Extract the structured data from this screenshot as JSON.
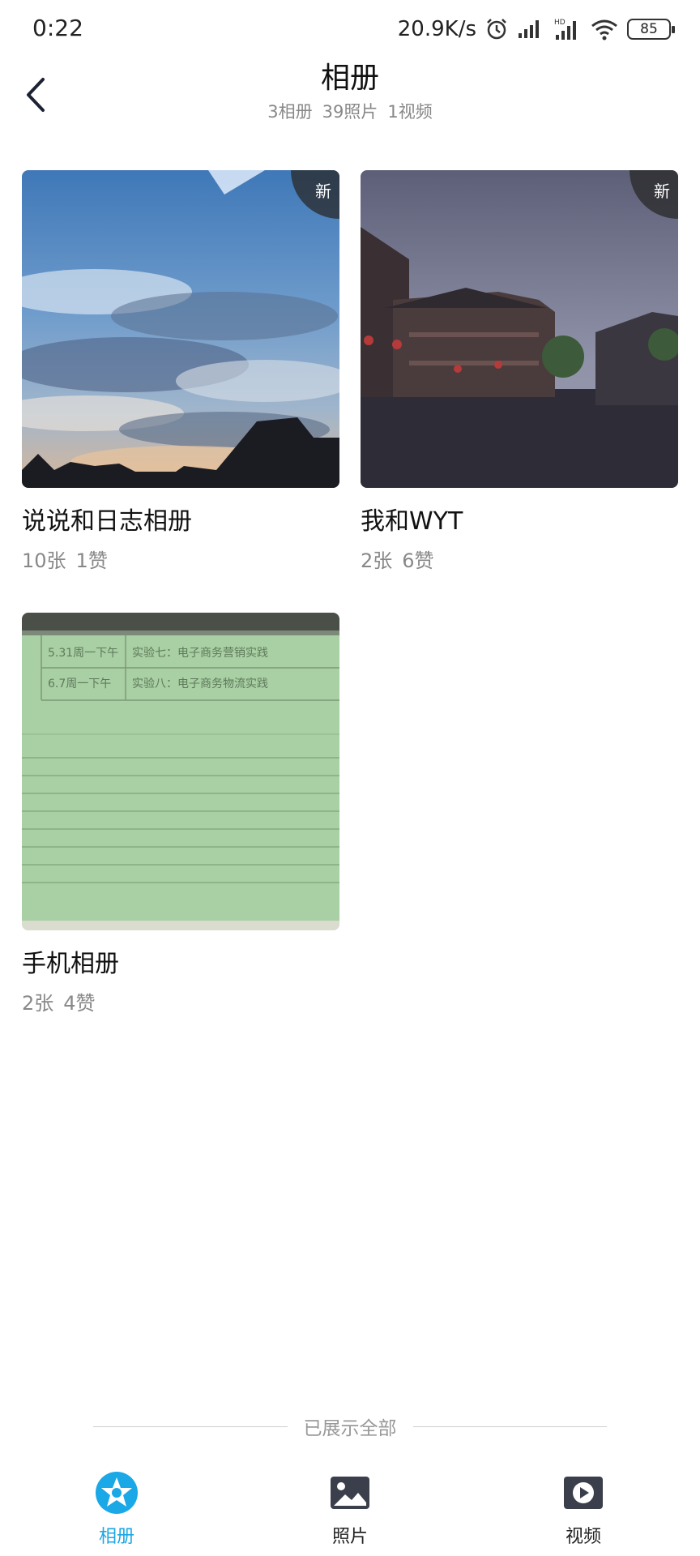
{
  "status_bar": {
    "time": "0:22",
    "net_speed": "20.9K/s",
    "battery": "85"
  },
  "header": {
    "title": "相册",
    "stats": [
      "3相册",
      "39照片",
      "1视频"
    ]
  },
  "albums": [
    {
      "name": "说说和日志相册",
      "count": "10张",
      "likes": "1赞",
      "badge": "新",
      "thumb_icon": "sky-clouds-photo"
    },
    {
      "name": "我和WYT",
      "count": "2张",
      "likes": "6赞",
      "badge": "新",
      "thumb_icon": "old-town-street-photo"
    },
    {
      "name": "手机相册",
      "count": "2张",
      "likes": "4赞",
      "badge": "",
      "thumb_icon": "document-screen-photo"
    }
  ],
  "thumb_text": {
    "row1_date": "5.31周一下午",
    "row1_item": "实验七：电子商务营销实践",
    "row2_date": "6.7周一下午",
    "row2_item": "实验八：电子商务物流实践"
  },
  "end_text": "已展示全部",
  "nav": [
    {
      "label": "相册",
      "icon": "album-star-icon",
      "active": true
    },
    {
      "label": "照片",
      "icon": "photo-icon",
      "active": false
    },
    {
      "label": "视频",
      "icon": "video-play-icon",
      "active": false
    }
  ],
  "colors": {
    "accent": "#1aa8e6",
    "text_primary": "#111111",
    "text_secondary": "#888888",
    "icon_dark": "#3a3f4b"
  }
}
